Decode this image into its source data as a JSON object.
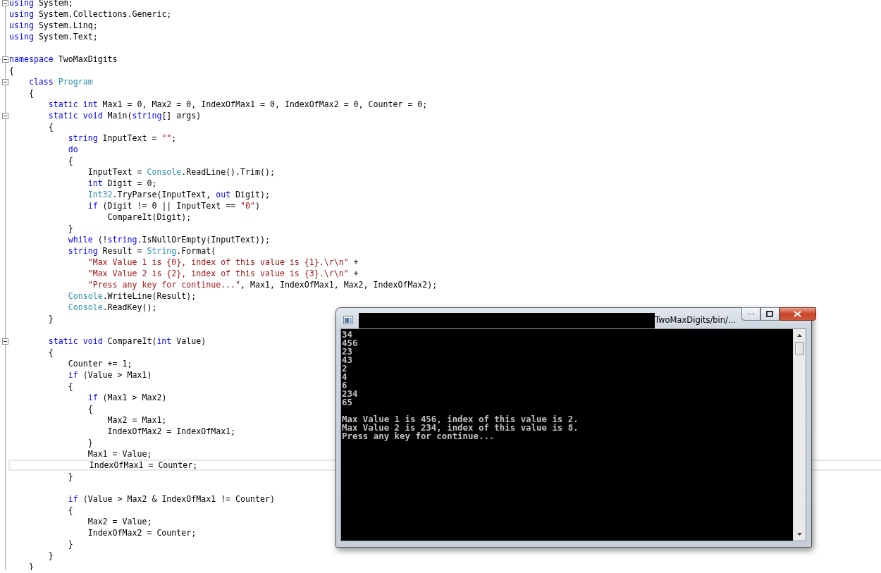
{
  "editor": {
    "lines": [
      {
        "fold": true,
        "current": false,
        "tokens": [
          {
            "kind": "keyword",
            "text": "using"
          },
          {
            "kind": "plain",
            "text": " System;"
          }
        ]
      },
      {
        "fold": false,
        "current": false,
        "tokens": [
          {
            "kind": "keyword",
            "text": "using"
          },
          {
            "kind": "plain",
            "text": " System.Collections.Generic;"
          }
        ]
      },
      {
        "fold": false,
        "current": false,
        "tokens": [
          {
            "kind": "keyword",
            "text": "using"
          },
          {
            "kind": "plain",
            "text": " System.Linq;"
          }
        ]
      },
      {
        "fold": false,
        "current": false,
        "tokens": [
          {
            "kind": "keyword",
            "text": "using"
          },
          {
            "kind": "plain",
            "text": " System.Text;"
          }
        ]
      },
      {
        "fold": false,
        "current": false
      },
      {
        "fold": true,
        "current": false,
        "tokens": [
          {
            "kind": "keyword",
            "text": "namespace"
          },
          {
            "kind": "plain",
            "text": " TwoMaxDigits"
          }
        ]
      },
      {
        "fold": false,
        "current": false,
        "tokens": [
          {
            "kind": "plain",
            "text": "{"
          }
        ]
      },
      {
        "fold": true,
        "current": false,
        "tokens": [
          {
            "kind": "keyword",
            "text": "    class "
          },
          {
            "kind": "type",
            "text": "Program"
          }
        ]
      },
      {
        "fold": false,
        "current": false,
        "tokens": [
          {
            "kind": "plain",
            "text": "    {"
          }
        ]
      },
      {
        "fold": false,
        "current": false,
        "tokens": [
          {
            "kind": "keyword",
            "text": "        static int"
          },
          {
            "kind": "plain",
            "text": " Max1 = 0, Max2 = 0, IndexOfMax1 = 0, IndexOfMax2 = 0, Counter = 0;"
          }
        ]
      },
      {
        "fold": true,
        "current": false,
        "tokens": [
          {
            "kind": "keyword",
            "text": "        static void"
          },
          {
            "kind": "plain",
            "text": " Main("
          },
          {
            "kind": "keyword",
            "text": "string"
          },
          {
            "kind": "plain",
            "text": "[] args)"
          }
        ]
      },
      {
        "fold": false,
        "current": false,
        "tokens": [
          {
            "kind": "plain",
            "text": "        {"
          }
        ]
      },
      {
        "fold": false,
        "current": false,
        "tokens": [
          {
            "kind": "keyword",
            "text": "            string"
          },
          {
            "kind": "plain",
            "text": " InputText = "
          },
          {
            "kind": "string",
            "text": "\"\""
          },
          {
            "kind": "plain",
            "text": ";"
          }
        ]
      },
      {
        "fold": false,
        "current": false,
        "tokens": [
          {
            "kind": "keyword",
            "text": "            do"
          }
        ]
      },
      {
        "fold": false,
        "current": false,
        "tokens": [
          {
            "kind": "plain",
            "text": "            {"
          }
        ]
      },
      {
        "fold": false,
        "current": false,
        "tokens": [
          {
            "kind": "plain",
            "text": "                InputText = "
          },
          {
            "kind": "type",
            "text": "Console"
          },
          {
            "kind": "plain",
            "text": ".ReadLine().Trim();"
          }
        ]
      },
      {
        "fold": false,
        "current": false,
        "tokens": [
          {
            "kind": "keyword",
            "text": "                int"
          },
          {
            "kind": "plain",
            "text": " Digit = 0;"
          }
        ]
      },
      {
        "fold": false,
        "current": false,
        "tokens": [
          {
            "kind": "type",
            "text": "                Int32"
          },
          {
            "kind": "plain",
            "text": ".TryParse(InputText, "
          },
          {
            "kind": "keyword",
            "text": "out"
          },
          {
            "kind": "plain",
            "text": " Digit);"
          }
        ]
      },
      {
        "fold": false,
        "current": false,
        "tokens": [
          {
            "kind": "keyword",
            "text": "                if"
          },
          {
            "kind": "plain",
            "text": " (Digit != 0 || InputText == "
          },
          {
            "kind": "string",
            "text": "\"0\""
          },
          {
            "kind": "plain",
            "text": ")"
          }
        ]
      },
      {
        "fold": false,
        "current": false,
        "tokens": [
          {
            "kind": "plain",
            "text": "                    CompareIt(Digit);"
          }
        ]
      },
      {
        "fold": false,
        "current": false,
        "tokens": [
          {
            "kind": "plain",
            "text": "            }"
          }
        ]
      },
      {
        "fold": false,
        "current": false,
        "tokens": [
          {
            "kind": "keyword",
            "text": "            while"
          },
          {
            "kind": "plain",
            "text": " (!"
          },
          {
            "kind": "keyword",
            "text": "string"
          },
          {
            "kind": "plain",
            "text": ".IsNullOrEmpty(InputText));"
          }
        ]
      },
      {
        "fold": false,
        "current": false,
        "tokens": [
          {
            "kind": "keyword",
            "text": "            string"
          },
          {
            "kind": "plain",
            "text": " Result = "
          },
          {
            "kind": "type",
            "text": "String"
          },
          {
            "kind": "plain",
            "text": ".Format("
          }
        ]
      },
      {
        "fold": false,
        "current": false,
        "tokens": [
          {
            "kind": "string",
            "text": "                \"Max Value 1 is {0}, index of this value is {1}.\\r\\n\""
          },
          {
            "kind": "plain",
            "text": " +"
          }
        ]
      },
      {
        "fold": false,
        "current": false,
        "tokens": [
          {
            "kind": "string",
            "text": "                \"Max Value 2 is {2}, index of this value is {3}.\\r\\n\""
          },
          {
            "kind": "plain",
            "text": " +"
          }
        ]
      },
      {
        "fold": false,
        "current": false,
        "tokens": [
          {
            "kind": "string",
            "text": "                \"Press any key for continue...\""
          },
          {
            "kind": "plain",
            "text": ", Max1, IndexOfMax1, Max2, IndexOfMax2);"
          }
        ]
      },
      {
        "fold": false,
        "current": false,
        "tokens": [
          {
            "kind": "type",
            "text": "            Console"
          },
          {
            "kind": "plain",
            "text": ".WriteLine(Result);"
          }
        ]
      },
      {
        "fold": false,
        "current": false,
        "tokens": [
          {
            "kind": "type",
            "text": "            Console"
          },
          {
            "kind": "plain",
            "text": ".ReadKey();"
          }
        ]
      },
      {
        "fold": false,
        "current": false,
        "tokens": [
          {
            "kind": "plain",
            "text": "        }"
          }
        ]
      },
      {
        "fold": false,
        "current": false
      },
      {
        "fold": true,
        "current": false,
        "tokens": [
          {
            "kind": "keyword",
            "text": "        static void"
          },
          {
            "kind": "plain",
            "text": " CompareIt("
          },
          {
            "kind": "keyword",
            "text": "int"
          },
          {
            "kind": "plain",
            "text": " Value)"
          }
        ]
      },
      {
        "fold": false,
        "current": false,
        "tokens": [
          {
            "kind": "plain",
            "text": "        {"
          }
        ]
      },
      {
        "fold": false,
        "current": false,
        "tokens": [
          {
            "kind": "plain",
            "text": "            Counter += 1;"
          }
        ]
      },
      {
        "fold": false,
        "current": false,
        "tokens": [
          {
            "kind": "keyword",
            "text": "            if"
          },
          {
            "kind": "plain",
            "text": " (Value > Max1)"
          }
        ]
      },
      {
        "fold": false,
        "current": false,
        "tokens": [
          {
            "kind": "plain",
            "text": "            {"
          }
        ]
      },
      {
        "fold": false,
        "current": false,
        "tokens": [
          {
            "kind": "keyword",
            "text": "                if"
          },
          {
            "kind": "plain",
            "text": " (Max1 > Max2)"
          }
        ]
      },
      {
        "fold": false,
        "current": false,
        "tokens": [
          {
            "kind": "plain",
            "text": "                {"
          }
        ]
      },
      {
        "fold": false,
        "current": false,
        "tokens": [
          {
            "kind": "plain",
            "text": "                    Max2 = Max1;"
          }
        ]
      },
      {
        "fold": false,
        "current": false,
        "tokens": [
          {
            "kind": "plain",
            "text": "                    IndexOfMax2 = IndexOfMax1;"
          }
        ]
      },
      {
        "fold": false,
        "current": false,
        "tokens": [
          {
            "kind": "plain",
            "text": "                }"
          }
        ]
      },
      {
        "fold": false,
        "current": false,
        "tokens": [
          {
            "kind": "plain",
            "text": "                Max1 = Value;"
          }
        ]
      },
      {
        "fold": false,
        "current": true,
        "tokens": [
          {
            "kind": "plain",
            "text": "                IndexOfMax1 = Counter;"
          }
        ]
      },
      {
        "fold": false,
        "current": false,
        "tokens": [
          {
            "kind": "plain",
            "text": "            }"
          }
        ]
      },
      {
        "fold": false,
        "current": false
      },
      {
        "fold": false,
        "current": false,
        "tokens": [
          {
            "kind": "keyword",
            "text": "            if"
          },
          {
            "kind": "plain",
            "text": " (Value > Max2 & IndexOfMax1 != Counter)"
          }
        ]
      },
      {
        "fold": false,
        "current": false,
        "tokens": [
          {
            "kind": "plain",
            "text": "            {"
          }
        ]
      },
      {
        "fold": false,
        "current": false,
        "tokens": [
          {
            "kind": "plain",
            "text": "                Max2 = Value;"
          }
        ]
      },
      {
        "fold": false,
        "current": false,
        "tokens": [
          {
            "kind": "plain",
            "text": "                IndexOfMax2 = Counter;"
          }
        ]
      },
      {
        "fold": false,
        "current": false,
        "tokens": [
          {
            "kind": "plain",
            "text": "            }"
          }
        ]
      },
      {
        "fold": false,
        "current": false,
        "tokens": [
          {
            "kind": "plain",
            "text": "        }"
          }
        ]
      },
      {
        "fold": false,
        "current": false,
        "tokens": [
          {
            "kind": "plain",
            "text": "    }"
          }
        ]
      }
    ]
  },
  "console_window": {
    "title": "TwoMaxDigits/bin/...",
    "input_lines": [
      "34",
      "456",
      "23",
      "43",
      "2",
      "4",
      "6",
      "234",
      "65"
    ],
    "output_lines": [
      "Max Value 1 is 456, index of this value is 2.",
      "Max Value 2 is 234, index of this value is 8.",
      "Press any key for continue..."
    ]
  }
}
